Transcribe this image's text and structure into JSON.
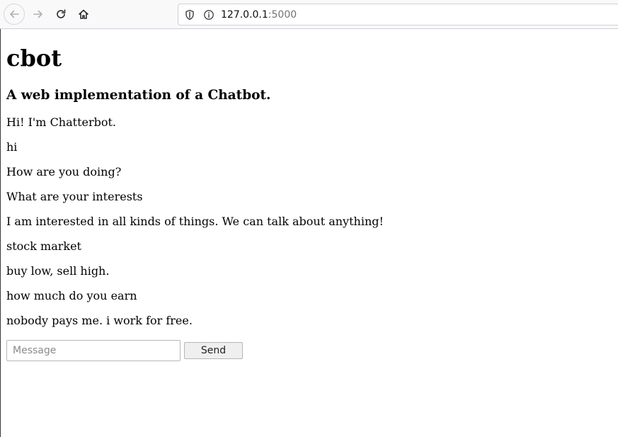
{
  "browser": {
    "url_host": "127.0.0.1",
    "url_port": ":5000",
    "icons": {
      "back": "arrow-left-icon",
      "forward": "arrow-right-icon",
      "reload": "reload-icon",
      "home": "home-icon",
      "shield": "shield-icon",
      "info": "info-icon"
    }
  },
  "page": {
    "title": "cbot",
    "subtitle": "A web implementation of a Chatbot."
  },
  "chat": {
    "messages": [
      "Hi! I'm Chatterbot.",
      "hi",
      "How are you doing?",
      "What are your interests",
      "I am interested in all kinds of things. We can talk about anything!",
      "stock market",
      "buy low, sell high.",
      "how much do you earn",
      "nobody pays me. i work for free."
    ],
    "input_placeholder": "Message",
    "input_value": "",
    "send_label": "Send"
  }
}
